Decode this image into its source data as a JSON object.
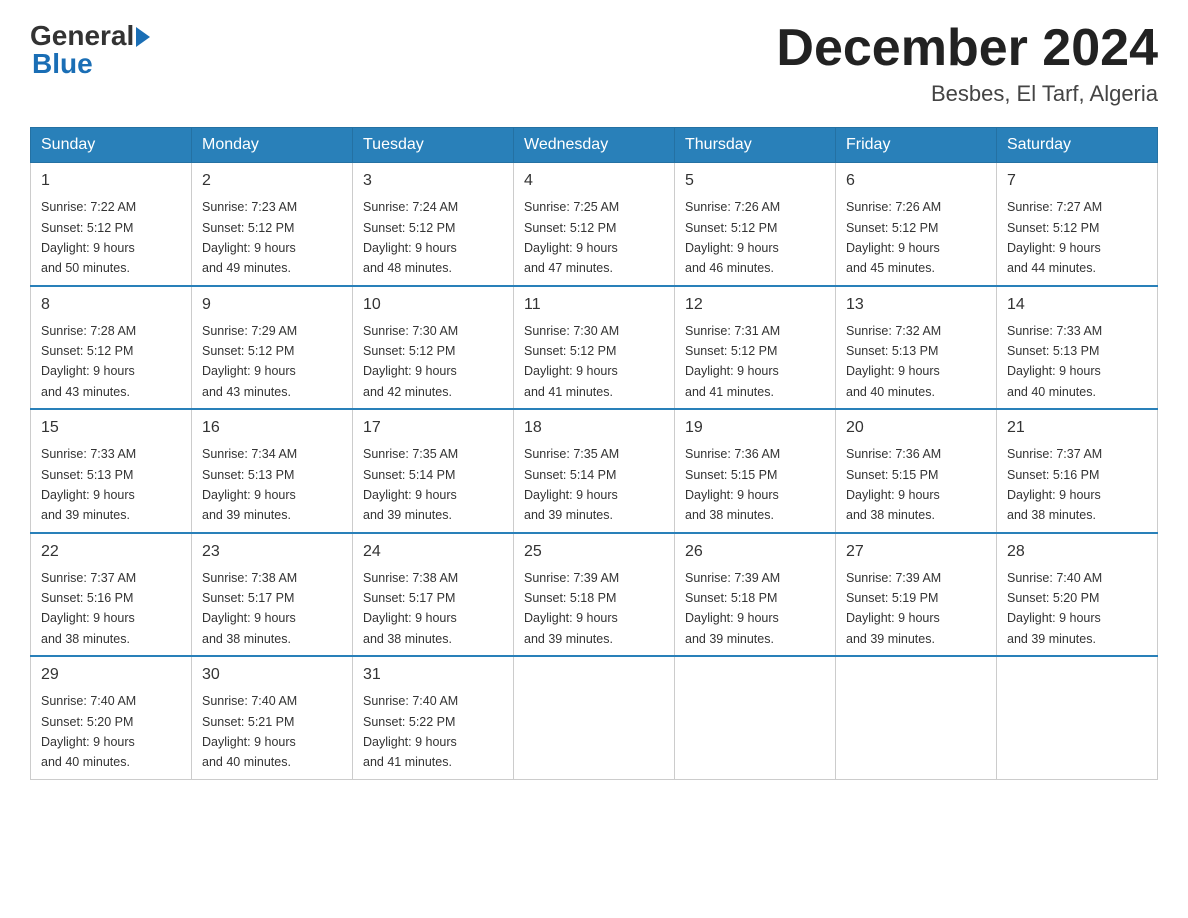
{
  "header": {
    "logo_general": "General",
    "logo_blue": "Blue",
    "title": "December 2024",
    "location": "Besbes, El Tarf, Algeria"
  },
  "days_of_week": [
    "Sunday",
    "Monday",
    "Tuesday",
    "Wednesday",
    "Thursday",
    "Friday",
    "Saturday"
  ],
  "weeks": [
    [
      {
        "day": "1",
        "sunrise": "7:22 AM",
        "sunset": "5:12 PM",
        "daylight": "9 hours and 50 minutes."
      },
      {
        "day": "2",
        "sunrise": "7:23 AM",
        "sunset": "5:12 PM",
        "daylight": "9 hours and 49 minutes."
      },
      {
        "day": "3",
        "sunrise": "7:24 AM",
        "sunset": "5:12 PM",
        "daylight": "9 hours and 48 minutes."
      },
      {
        "day": "4",
        "sunrise": "7:25 AM",
        "sunset": "5:12 PM",
        "daylight": "9 hours and 47 minutes."
      },
      {
        "day": "5",
        "sunrise": "7:26 AM",
        "sunset": "5:12 PM",
        "daylight": "9 hours and 46 minutes."
      },
      {
        "day": "6",
        "sunrise": "7:26 AM",
        "sunset": "5:12 PM",
        "daylight": "9 hours and 45 minutes."
      },
      {
        "day": "7",
        "sunrise": "7:27 AM",
        "sunset": "5:12 PM",
        "daylight": "9 hours and 44 minutes."
      }
    ],
    [
      {
        "day": "8",
        "sunrise": "7:28 AM",
        "sunset": "5:12 PM",
        "daylight": "9 hours and 43 minutes."
      },
      {
        "day": "9",
        "sunrise": "7:29 AM",
        "sunset": "5:12 PM",
        "daylight": "9 hours and 43 minutes."
      },
      {
        "day": "10",
        "sunrise": "7:30 AM",
        "sunset": "5:12 PM",
        "daylight": "9 hours and 42 minutes."
      },
      {
        "day": "11",
        "sunrise": "7:30 AM",
        "sunset": "5:12 PM",
        "daylight": "9 hours and 41 minutes."
      },
      {
        "day": "12",
        "sunrise": "7:31 AM",
        "sunset": "5:12 PM",
        "daylight": "9 hours and 41 minutes."
      },
      {
        "day": "13",
        "sunrise": "7:32 AM",
        "sunset": "5:13 PM",
        "daylight": "9 hours and 40 minutes."
      },
      {
        "day": "14",
        "sunrise": "7:33 AM",
        "sunset": "5:13 PM",
        "daylight": "9 hours and 40 minutes."
      }
    ],
    [
      {
        "day": "15",
        "sunrise": "7:33 AM",
        "sunset": "5:13 PM",
        "daylight": "9 hours and 39 minutes."
      },
      {
        "day": "16",
        "sunrise": "7:34 AM",
        "sunset": "5:13 PM",
        "daylight": "9 hours and 39 minutes."
      },
      {
        "day": "17",
        "sunrise": "7:35 AM",
        "sunset": "5:14 PM",
        "daylight": "9 hours and 39 minutes."
      },
      {
        "day": "18",
        "sunrise": "7:35 AM",
        "sunset": "5:14 PM",
        "daylight": "9 hours and 39 minutes."
      },
      {
        "day": "19",
        "sunrise": "7:36 AM",
        "sunset": "5:15 PM",
        "daylight": "9 hours and 38 minutes."
      },
      {
        "day": "20",
        "sunrise": "7:36 AM",
        "sunset": "5:15 PM",
        "daylight": "9 hours and 38 minutes."
      },
      {
        "day": "21",
        "sunrise": "7:37 AM",
        "sunset": "5:16 PM",
        "daylight": "9 hours and 38 minutes."
      }
    ],
    [
      {
        "day": "22",
        "sunrise": "7:37 AM",
        "sunset": "5:16 PM",
        "daylight": "9 hours and 38 minutes."
      },
      {
        "day": "23",
        "sunrise": "7:38 AM",
        "sunset": "5:17 PM",
        "daylight": "9 hours and 38 minutes."
      },
      {
        "day": "24",
        "sunrise": "7:38 AM",
        "sunset": "5:17 PM",
        "daylight": "9 hours and 38 minutes."
      },
      {
        "day": "25",
        "sunrise": "7:39 AM",
        "sunset": "5:18 PM",
        "daylight": "9 hours and 39 minutes."
      },
      {
        "day": "26",
        "sunrise": "7:39 AM",
        "sunset": "5:18 PM",
        "daylight": "9 hours and 39 minutes."
      },
      {
        "day": "27",
        "sunrise": "7:39 AM",
        "sunset": "5:19 PM",
        "daylight": "9 hours and 39 minutes."
      },
      {
        "day": "28",
        "sunrise": "7:40 AM",
        "sunset": "5:20 PM",
        "daylight": "9 hours and 39 minutes."
      }
    ],
    [
      {
        "day": "29",
        "sunrise": "7:40 AM",
        "sunset": "5:20 PM",
        "daylight": "9 hours and 40 minutes."
      },
      {
        "day": "30",
        "sunrise": "7:40 AM",
        "sunset": "5:21 PM",
        "daylight": "9 hours and 40 minutes."
      },
      {
        "day": "31",
        "sunrise": "7:40 AM",
        "sunset": "5:22 PM",
        "daylight": "9 hours and 41 minutes."
      },
      null,
      null,
      null,
      null
    ]
  ],
  "labels": {
    "sunrise": "Sunrise:",
    "sunset": "Sunset:",
    "daylight": "Daylight:"
  }
}
